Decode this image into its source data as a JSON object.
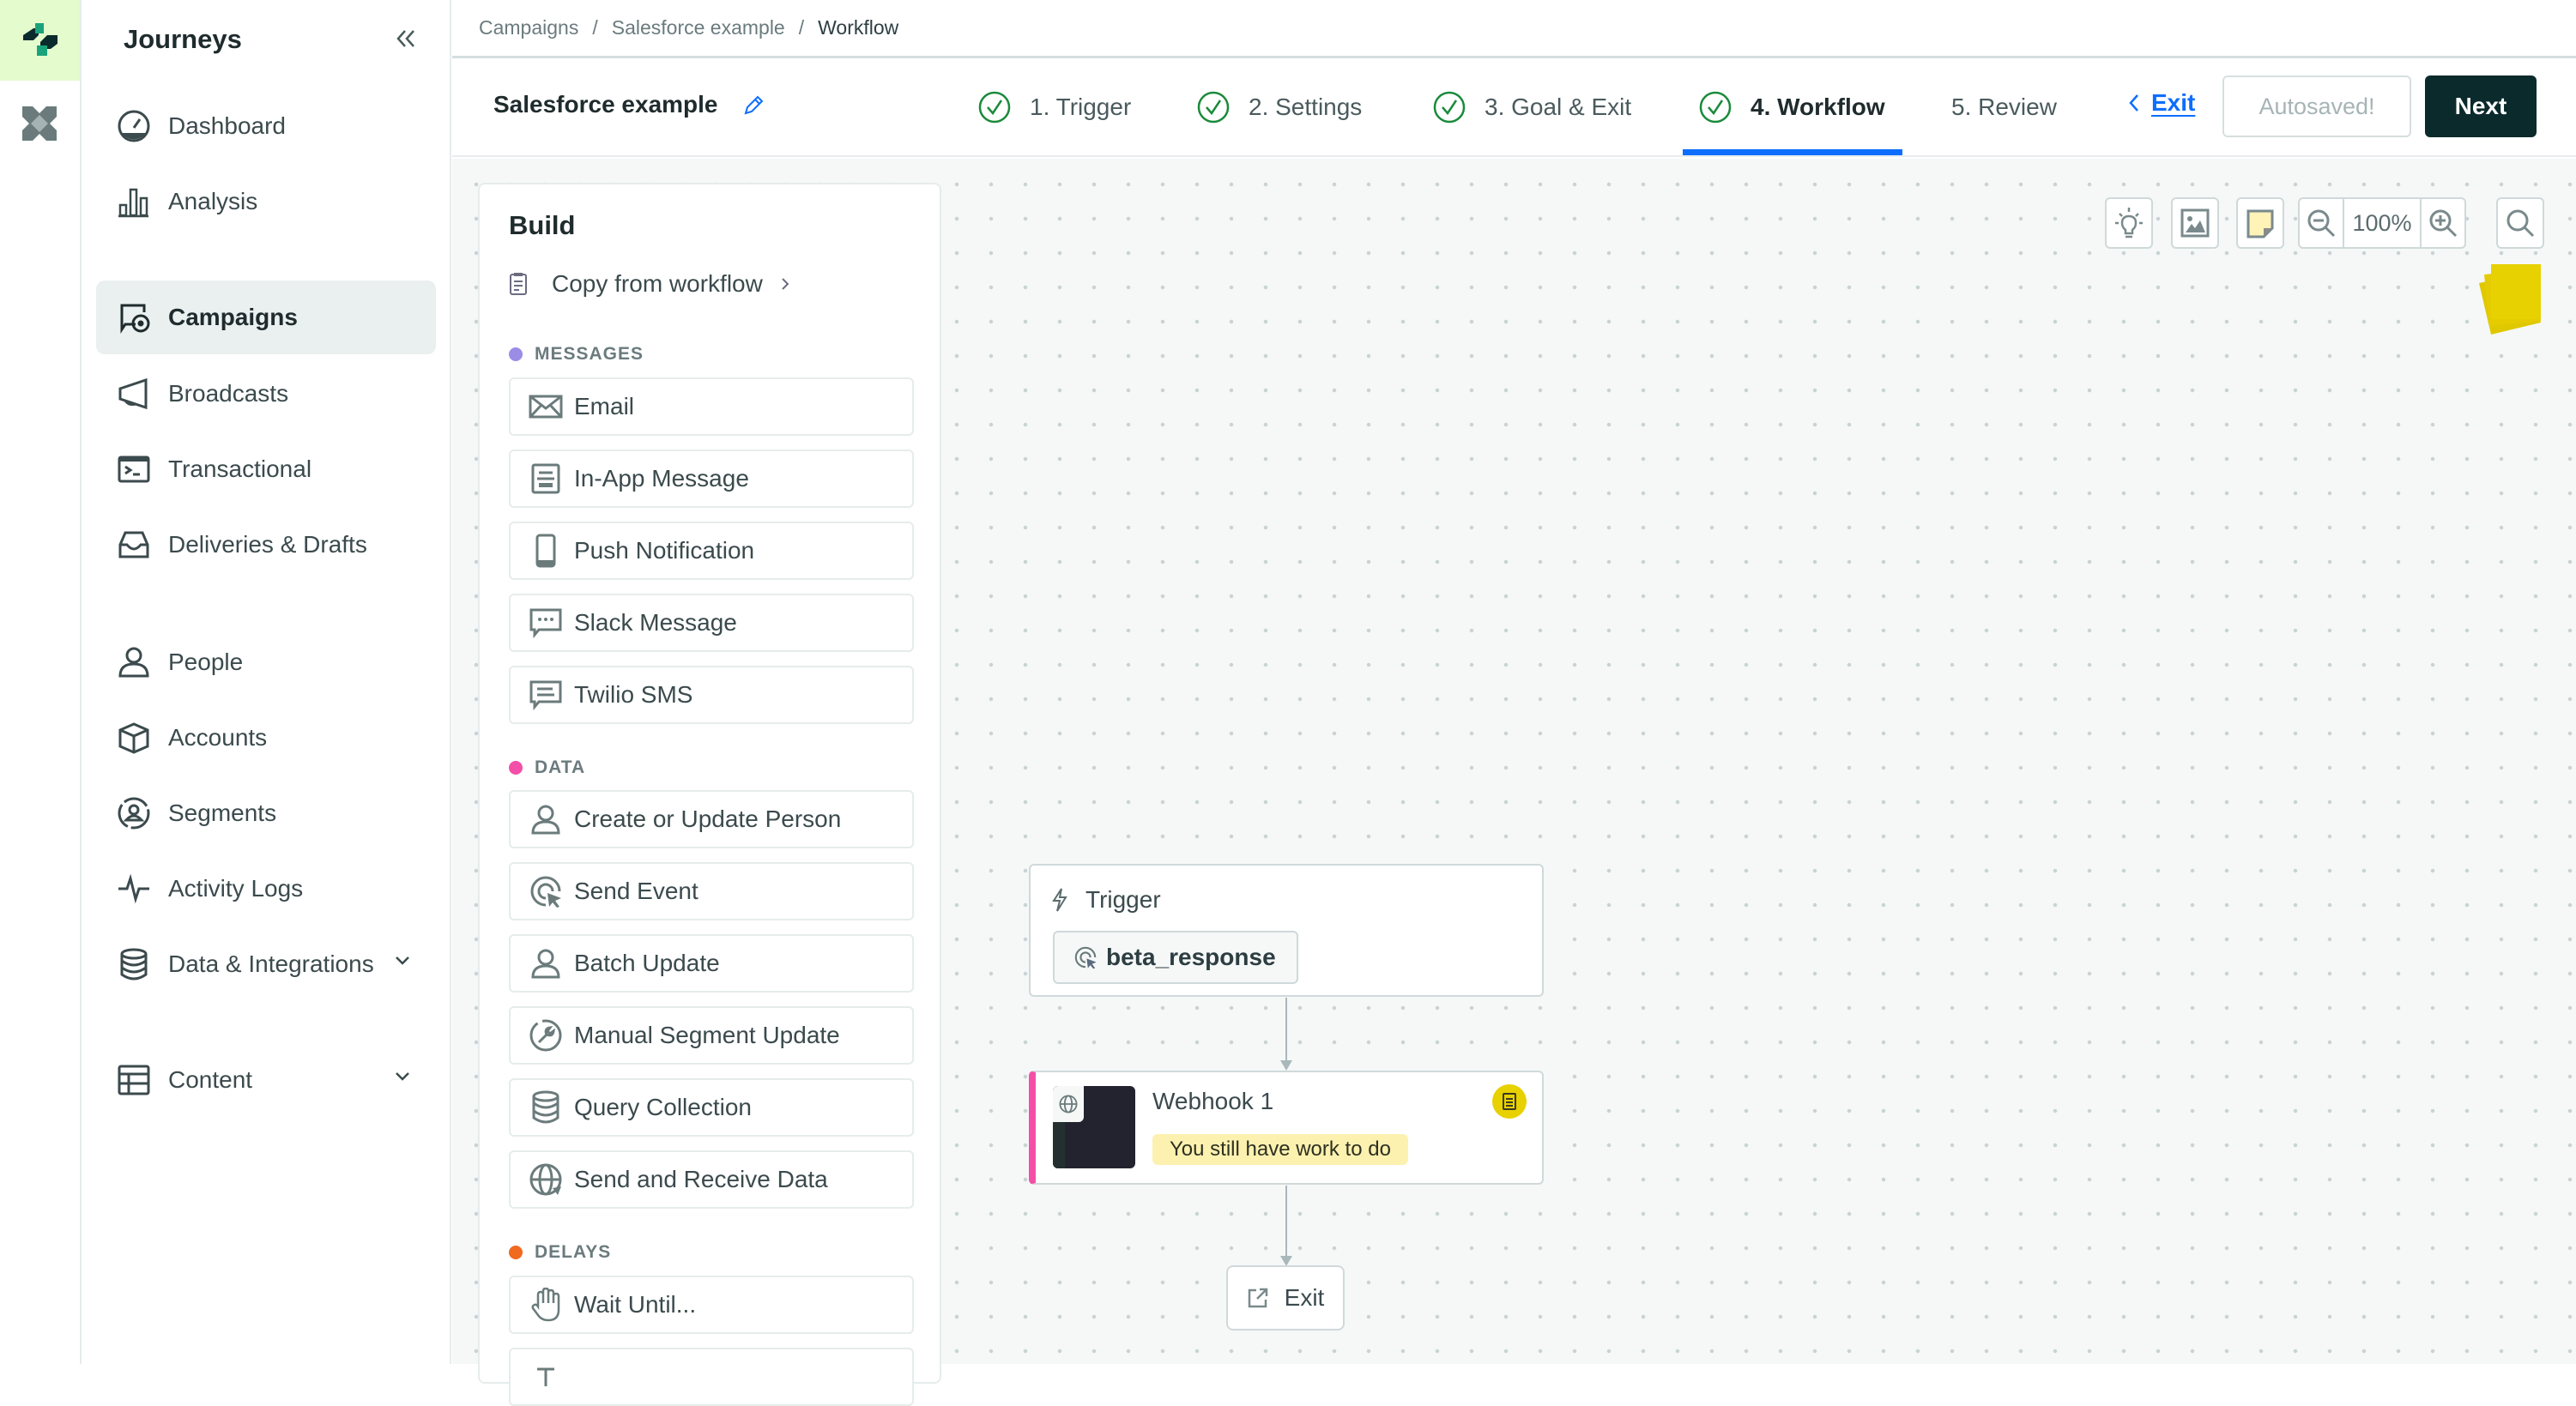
{
  "app": {
    "section_title": "Journeys"
  },
  "nav": {
    "items": [
      {
        "label": "Dashboard",
        "icon": "dashboard-icon"
      },
      {
        "label": "Analysis",
        "icon": "bar-chart-icon"
      },
      {
        "label": "Campaigns",
        "icon": "campaigns-icon",
        "active": true
      },
      {
        "label": "Broadcasts",
        "icon": "megaphone-icon"
      },
      {
        "label": "Transactional",
        "icon": "terminal-icon"
      },
      {
        "label": "Deliveries & Drafts",
        "icon": "inbox-icon"
      },
      {
        "label": "People",
        "icon": "person-icon"
      },
      {
        "label": "Accounts",
        "icon": "cube-icon"
      },
      {
        "label": "Segments",
        "icon": "segment-icon"
      },
      {
        "label": "Activity Logs",
        "icon": "pulse-icon"
      },
      {
        "label": "Data & Integrations",
        "icon": "database-icon",
        "expandable": true
      },
      {
        "label": "Content",
        "icon": "layout-icon",
        "expandable": true
      }
    ]
  },
  "breadcrumb": [
    "Campaigns",
    "Salesforce example",
    "Workflow"
  ],
  "header": {
    "campaign_name": "Salesforce example",
    "steps": [
      {
        "label": "1. Trigger",
        "complete": true
      },
      {
        "label": "2. Settings",
        "complete": true
      },
      {
        "label": "3. Goal & Exit",
        "complete": true
      },
      {
        "label": "4. Workflow",
        "complete": true,
        "active": true
      },
      {
        "label": "5. Review",
        "complete": false
      }
    ],
    "exit_label": "Exit",
    "autosaved_label": "Autosaved!",
    "next_label": "Next"
  },
  "build": {
    "title": "Build",
    "copy_label": "Copy from workflow",
    "sections": [
      {
        "label": "MESSAGES",
        "color": "#9b8ce6",
        "items": [
          "Email",
          "In-App Message",
          "Push Notification",
          "Slack Message",
          "Twilio SMS"
        ]
      },
      {
        "label": "DATA",
        "color": "#f44fa8",
        "items": [
          "Create or Update Person",
          "Send Event",
          "Batch Update",
          "Manual Segment Update",
          "Query Collection",
          "Send and Receive Data"
        ]
      },
      {
        "label": "DELAYS",
        "color": "#f06a1f",
        "items": [
          "Wait Until..."
        ]
      }
    ]
  },
  "toolbar": {
    "zoom_level": "100%"
  },
  "workflow": {
    "trigger": {
      "title": "Trigger",
      "event": "beta_response"
    },
    "webhook": {
      "title": "Webhook 1",
      "warning": "You still have work to do"
    },
    "exit": {
      "label": "Exit"
    }
  },
  "colors": {
    "accent": "#0d6efd",
    "primary_button": "#0b2a2c",
    "complete": "#1a8a3a",
    "webhook_stripe": "#f44fa8",
    "warning_bg": "#fdf1b0",
    "sticky": "#e8d100"
  }
}
